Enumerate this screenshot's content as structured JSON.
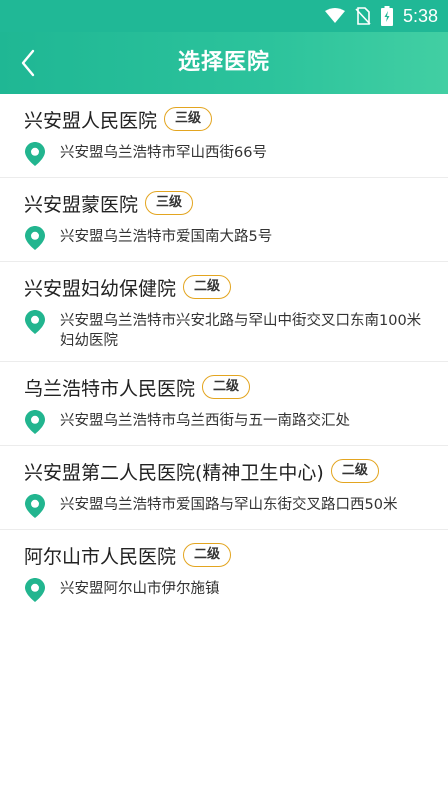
{
  "status_bar": {
    "time": "5:38",
    "icons": [
      "wifi-icon",
      "no-sim-icon",
      "battery-charging-icon"
    ]
  },
  "header": {
    "title": "选择医院",
    "back_icon": "chevron-left-icon"
  },
  "colors": {
    "header": "#20b896",
    "badge_border": "#e3a520",
    "pin": "#22b58f"
  },
  "hospitals": [
    {
      "name": "兴安盟人民医院",
      "level": "三级",
      "address": "兴安盟乌兰浩特市罕山西街66号"
    },
    {
      "name": "兴安盟蒙医院",
      "level": "三级",
      "address": "兴安盟乌兰浩特市爱国南大路5号"
    },
    {
      "name": "兴安盟妇幼保健院",
      "level": "二级",
      "address": "兴安盟乌兰浩特市兴安北路与罕山中街交叉口东南100米妇幼医院"
    },
    {
      "name": "乌兰浩特市人民医院",
      "level": "二级",
      "address": "兴安盟乌兰浩特市乌兰西街与五一南路交汇处"
    },
    {
      "name": "兴安盟第二人民医院(精神卫生中心)",
      "level": "二级",
      "address": "兴安盟乌兰浩特市爱国路与罕山东街交叉路口西50米"
    },
    {
      "name": "阿尔山市人民医院",
      "level": "二级",
      "address": "兴安盟阿尔山市伊尔施镇"
    }
  ]
}
